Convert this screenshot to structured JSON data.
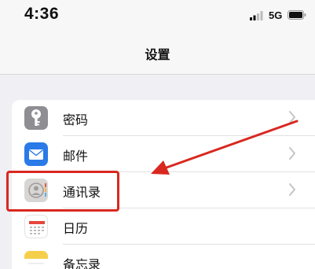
{
  "status_bar": {
    "time": "4:36",
    "network": "5G"
  },
  "nav": {
    "title": "设置"
  },
  "settings": {
    "items": [
      {
        "label": "密码",
        "icon": "key-icon"
      },
      {
        "label": "邮件",
        "icon": "mail-icon"
      },
      {
        "label": "通讯录",
        "icon": "contacts-icon"
      },
      {
        "label": "日历",
        "icon": "calendar-icon"
      },
      {
        "label": "备忘录",
        "icon": "notes-icon"
      }
    ]
  },
  "annotation": {
    "color": "#d8281f",
    "highlighted_item": "通讯录"
  },
  "colors": {
    "background": "#efeff4",
    "password_icon": "#8e8e93",
    "mail_icon": "#2a7ae8",
    "contacts_icon": "#d7d6d4",
    "notes_icon": "#f6cf4a"
  }
}
